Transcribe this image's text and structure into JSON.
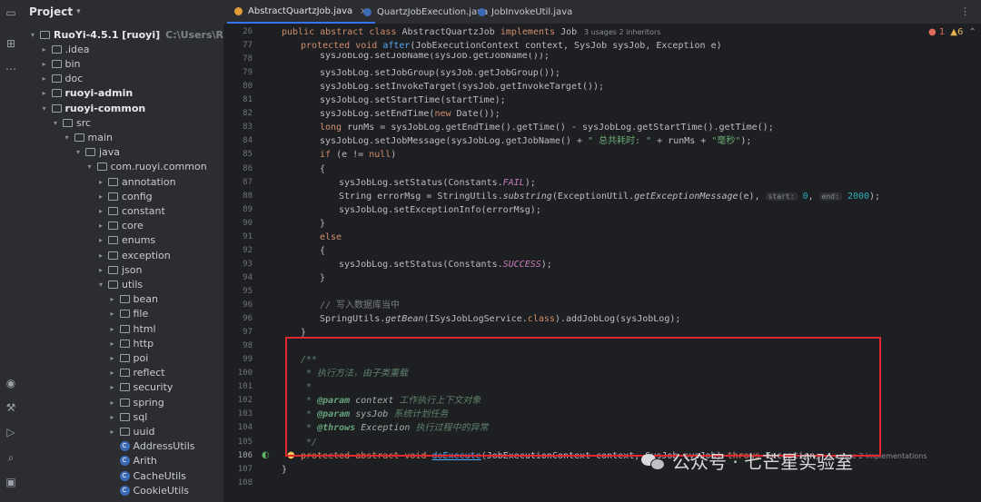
{
  "panel": {
    "title": "Project",
    "tree": [
      {
        "label": "RuoYi-4.5.1 [ruoyi]",
        "extra": "C:\\Users\\RedTeam\\Deskt",
        "depth": 0,
        "open": true,
        "type": "folder",
        "bold": true
      },
      {
        "label": ".idea",
        "depth": 1,
        "open": false,
        "type": "folder"
      },
      {
        "label": "bin",
        "depth": 1,
        "open": false,
        "type": "folder"
      },
      {
        "label": "doc",
        "depth": 1,
        "open": false,
        "type": "folder"
      },
      {
        "label": "ruoyi-admin",
        "depth": 1,
        "open": false,
        "type": "folder",
        "bold": true
      },
      {
        "label": "ruoyi-common",
        "depth": 1,
        "open": true,
        "type": "folder",
        "bold": true
      },
      {
        "label": "src",
        "depth": 2,
        "open": true,
        "type": "folder"
      },
      {
        "label": "main",
        "depth": 3,
        "open": true,
        "type": "folder"
      },
      {
        "label": "java",
        "depth": 4,
        "open": true,
        "type": "folder"
      },
      {
        "label": "com.ruoyi.common",
        "depth": 5,
        "open": true,
        "type": "pkg"
      },
      {
        "label": "annotation",
        "depth": 6,
        "open": false,
        "type": "pkg"
      },
      {
        "label": "config",
        "depth": 6,
        "open": false,
        "type": "pkg"
      },
      {
        "label": "constant",
        "depth": 6,
        "open": false,
        "type": "pkg"
      },
      {
        "label": "core",
        "depth": 6,
        "open": false,
        "type": "pkg"
      },
      {
        "label": "enums",
        "depth": 6,
        "open": false,
        "type": "pkg"
      },
      {
        "label": "exception",
        "depth": 6,
        "open": false,
        "type": "pkg"
      },
      {
        "label": "json",
        "depth": 6,
        "open": false,
        "type": "pkg"
      },
      {
        "label": "utils",
        "depth": 6,
        "open": true,
        "type": "pkg"
      },
      {
        "label": "bean",
        "depth": 7,
        "open": false,
        "type": "pkg"
      },
      {
        "label": "file",
        "depth": 7,
        "open": false,
        "type": "pkg"
      },
      {
        "label": "html",
        "depth": 7,
        "open": false,
        "type": "pkg"
      },
      {
        "label": "http",
        "depth": 7,
        "open": false,
        "type": "pkg"
      },
      {
        "label": "poi",
        "depth": 7,
        "open": false,
        "type": "pkg"
      },
      {
        "label": "reflect",
        "depth": 7,
        "open": false,
        "type": "pkg"
      },
      {
        "label": "security",
        "depth": 7,
        "open": false,
        "type": "pkg"
      },
      {
        "label": "spring",
        "depth": 7,
        "open": false,
        "type": "pkg"
      },
      {
        "label": "sql",
        "depth": 7,
        "open": false,
        "type": "pkg"
      },
      {
        "label": "uuid",
        "depth": 7,
        "open": false,
        "type": "pkg"
      },
      {
        "label": "AddressUtils",
        "depth": 7,
        "type": "class"
      },
      {
        "label": "Arith",
        "depth": 7,
        "type": "class"
      },
      {
        "label": "CacheUtils",
        "depth": 7,
        "type": "class"
      },
      {
        "label": "CookieUtils",
        "depth": 7,
        "type": "class"
      }
    ]
  },
  "tabs": [
    {
      "label": "AbstractQuartzJob.java",
      "color": "#e09e3b",
      "active": true,
      "closable": true
    },
    {
      "label": "QuartzJobExecution.java",
      "color": "#3d6ab5",
      "active": false,
      "closable": false
    },
    {
      "label": "JobInvokeUtil.java",
      "color": "#3d6ab5",
      "active": false,
      "closable": false
    }
  ],
  "inspections": {
    "errors": "1",
    "warnings": "6"
  },
  "editor": {
    "lines": [
      {
        "n": "26",
        "indent": 0,
        "html": "<span class=\"kw\">public abstract class </span>AbstractQuartzJob <span class=\"kw\">implements </span>Job",
        "hint": "3 usages   2 inheritors"
      },
      {
        "n": "77",
        "indent": 1,
        "html": "<span class=\"kw\">protected void </span><span class=\"fn\">after</span>(JobExecutionContext <span class=\"it\" style=\"color:#bcbec4;font-style:normal\">context</span>, SysJob sysJob, Exception e)"
      },
      {
        "n": "78",
        "indent": 2,
        "html": "sysJobLog.setJobName(sysJob.getJobName());",
        "partial": true
      },
      {
        "n": "79",
        "indent": 2,
        "html": "sysJobLog.setJobGroup(sysJob.getJobGroup());"
      },
      {
        "n": "80",
        "indent": 2,
        "html": "sysJobLog.setInvokeTarget(sysJob.getInvokeTarget());"
      },
      {
        "n": "81",
        "indent": 2,
        "html": "sysJobLog.setStartTime(startTime);"
      },
      {
        "n": "82",
        "indent": 2,
        "html": "sysJobLog.setEndTime(<span class=\"kw\">new </span>Date());"
      },
      {
        "n": "83",
        "indent": 2,
        "html": "<span class=\"kw\">long </span>runMs = sysJobLog.getEndTime().getTime() - sysJobLog.getStartTime().getTime();"
      },
      {
        "n": "84",
        "indent": 2,
        "html": "sysJobLog.setJobMessage(sysJobLog.getJobName() + <span class=\"st\">\" 总共耗时: \"</span> + runMs + <span class=\"st\">\"毫秒\"</span>);"
      },
      {
        "n": "85",
        "indent": 2,
        "html": "<span class=\"kw\">if </span>(e != <span class=\"kw\">null</span>)"
      },
      {
        "n": "86",
        "indent": 2,
        "html": "{"
      },
      {
        "n": "87",
        "indent": 3,
        "html": "sysJobLog.setStatus(Constants.<span class=\"it\">FAIL</span>);"
      },
      {
        "n": "88",
        "indent": 3,
        "html": "String errorMsg = StringUtils.<span class=\"fi\">substring</span>(ExceptionUtil.<span class=\"fi\">getExceptionMessage</span>(e), <span class=\"hint\">start:</span> <span style=\"color:#2aacb8\">0</span>, <span class=\"hint\">end:</span> <span style=\"color:#2aacb8\">2000</span>);"
      },
      {
        "n": "89",
        "indent": 3,
        "html": "sysJobLog.setExceptionInfo(errorMsg);"
      },
      {
        "n": "90",
        "indent": 2,
        "html": "}"
      },
      {
        "n": "91",
        "indent": 2,
        "html": "<span class=\"kw\">else</span>"
      },
      {
        "n": "92",
        "indent": 2,
        "html": "{"
      },
      {
        "n": "93",
        "indent": 3,
        "html": "sysJobLog.setStatus(Constants.<span class=\"it\">SUCCESS</span>);"
      },
      {
        "n": "94",
        "indent": 2,
        "html": "}"
      },
      {
        "n": "95",
        "indent": 2,
        "html": ""
      },
      {
        "n": "96",
        "indent": 2,
        "html": "<span class=\"cm\">// 写入数据库当中</span>"
      },
      {
        "n": "96",
        "indent": 2,
        "html": "SpringUtils.<span class=\"fi\">getBean</span>(ISysJobLogService.<span class=\"kw\">class</span>).addJobLog(sysJobLog);"
      },
      {
        "n": "97",
        "indent": 1,
        "html": "}"
      },
      {
        "n": "98",
        "indent": 1,
        "html": ""
      },
      {
        "n": "99",
        "indent": 1,
        "html": "<span class=\"dc\">/**</span>"
      },
      {
        "n": "100",
        "indent": 1,
        "html": "<span class=\"dc\"> * 执行方法，由子类重载</span>"
      },
      {
        "n": "101",
        "indent": 1,
        "html": "<span class=\"dc\"> *</span>"
      },
      {
        "n": "102",
        "indent": 1,
        "html": "<span class=\"dc\"> * </span><span class=\"dtag\">@param</span><span class=\"dpar\"> context</span><span class=\"dc\"> 工作执行上下文对象</span>"
      },
      {
        "n": "103",
        "indent": 1,
        "html": "<span class=\"dc\"> * </span><span class=\"dtag\">@param</span><span class=\"dpar\"> sysJob</span><span class=\"dc\"> 系统计划任务</span>"
      },
      {
        "n": "104",
        "indent": 1,
        "html": "<span class=\"dc\"> * </span><span class=\"dtag\">@throws</span><span class=\"dpar\"> Exception</span><span class=\"dc\"> 执行过程中的异常</span>"
      },
      {
        "n": "105",
        "indent": 1,
        "html": "<span class=\"dc\"> */</span>"
      },
      {
        "n": "106",
        "indent": 1,
        "html": "<span class=\"kw\">protected abstract void </span><span class=\"fn ul\">doExecute</span>(JobExecutionContext context, SysJob sysJob) <span class=\"kw\">throws </span>Exception;",
        "hint": "1 usage   2 implementations",
        "current": true
      },
      {
        "n": "107",
        "indent": 0,
        "html": "}"
      },
      {
        "n": "108",
        "indent": 0,
        "html": ""
      }
    ]
  },
  "watermark": {
    "text": "公众号 · 七芒星实验室"
  }
}
